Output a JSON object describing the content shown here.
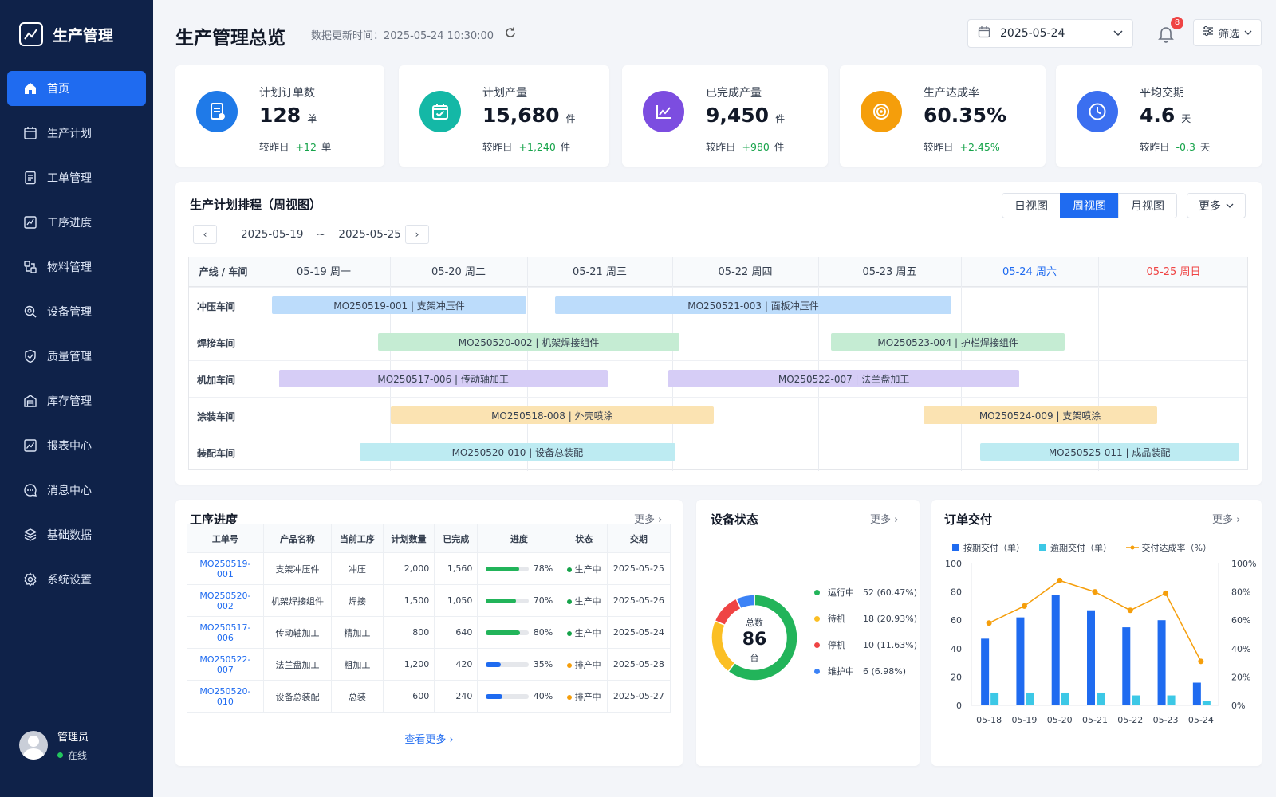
{
  "app": {
    "name": "生产管理"
  },
  "nav": [
    {
      "label": "首页",
      "icon": "home-icon",
      "active": true
    },
    {
      "label": "生产计划",
      "icon": "calendar-icon"
    },
    {
      "label": "工单管理",
      "icon": "document-icon"
    },
    {
      "label": "工序进度",
      "icon": "progress-icon"
    },
    {
      "label": "物料管理",
      "icon": "material-icon"
    },
    {
      "label": "设备管理",
      "icon": "search-icon"
    },
    {
      "label": "质量管理",
      "icon": "shield-icon"
    },
    {
      "label": "库存管理",
      "icon": "warehouse-icon"
    },
    {
      "label": "报表中心",
      "icon": "chart-icon"
    },
    {
      "label": "消息中心",
      "icon": "message-icon"
    },
    {
      "label": "基础数据",
      "icon": "layers-icon"
    },
    {
      "label": "系统设置",
      "icon": "gear-icon"
    }
  ],
  "user": {
    "name": "管理员",
    "status": "在线"
  },
  "header": {
    "title": "生产管理总览",
    "update_time": "数据更新时间：2025-05-24 10:30:00",
    "date": "2025-05-24",
    "notification_count": "8",
    "filter_label": "筛选"
  },
  "kpis": [
    {
      "label": "计划订单数",
      "value": "128",
      "unit": "单",
      "cmp_label": "较昨日",
      "delta": "+12",
      "delta_unit": "单",
      "color": "#1f7ae8"
    },
    {
      "label": "计划产量",
      "value": "15,680",
      "unit": "件",
      "cmp_label": "较昨日",
      "delta": "+1,240",
      "delta_unit": "件",
      "color": "#14b8a6"
    },
    {
      "label": "已完成产量",
      "value": "9,450",
      "unit": "件",
      "cmp_label": "较昨日",
      "delta": "+980",
      "delta_unit": "件",
      "color": "#7c4de0"
    },
    {
      "label": "生产达成率",
      "value": "60.35%",
      "unit": "",
      "cmp_label": "较昨日",
      "delta": "+2.45%",
      "delta_unit": "",
      "color": "#f59e0b"
    },
    {
      "label": "平均交期",
      "value": "4.6",
      "unit": "天",
      "cmp_label": "较昨日",
      "delta": "-0.3",
      "delta_unit": "天",
      "color": "#3b6ff0"
    }
  ],
  "schedule": {
    "title": "生产计划排程（周视图）",
    "views": [
      "日视图",
      "周视图",
      "月视图"
    ],
    "active_view": "周视图",
    "more_label": "更多",
    "range_start": "2025-05-19",
    "range_sep": "~",
    "range_end": "2025-05-25",
    "corner_label": "产线 / 车间",
    "days": [
      {
        "label": "05-19 周一",
        "color": "#374151"
      },
      {
        "label": "05-20 周二",
        "color": "#374151"
      },
      {
        "label": "05-21 周三",
        "color": "#374151"
      },
      {
        "label": "05-22 周四",
        "color": "#374151"
      },
      {
        "label": "05-23 周五",
        "color": "#374151"
      },
      {
        "label": "05-24 周六",
        "color": "#1f6bf0"
      },
      {
        "label": "05-25 周日",
        "color": "#ef4444"
      }
    ],
    "rows": [
      "冲压车间",
      "焊接车间",
      "机加车间",
      "涂装车间",
      "装配车间"
    ],
    "tasks": [
      {
        "row": 0,
        "label": "MO250519-001 | 支架冲压件",
        "start": 0.1,
        "end": 1.9,
        "color": "#bcdcfb"
      },
      {
        "row": 0,
        "label": "MO250521-003 | 面板冲压件",
        "start": 2.1,
        "end": 4.9,
        "color": "#bcdcfb"
      },
      {
        "row": 1,
        "label": "MO250520-002 | 机架焊接组件",
        "start": 0.85,
        "end": 2.98,
        "color": "#c5ecd3"
      },
      {
        "row": 1,
        "label": "MO250523-004 | 护栏焊接组件",
        "start": 4.05,
        "end": 5.7,
        "color": "#c5ecd3"
      },
      {
        "row": 2,
        "label": "MO250517-006 | 传动轴加工",
        "start": 0.15,
        "end": 2.47,
        "color": "#d6cdf6"
      },
      {
        "row": 2,
        "label": "MO250522-007 | 法兰盘加工",
        "start": 2.9,
        "end": 5.38,
        "color": "#d6cdf6"
      },
      {
        "row": 3,
        "label": "MO250518-008 | 外壳喷涂",
        "start": 0.94,
        "end": 3.22,
        "color": "#fbe3b2"
      },
      {
        "row": 3,
        "label": "MO250524-009 | 支架喷涂",
        "start": 4.7,
        "end": 6.35,
        "color": "#fbe3b2"
      },
      {
        "row": 4,
        "label": "MO250520-010 | 设备总装配",
        "start": 0.72,
        "end": 2.95,
        "color": "#bdebf2"
      },
      {
        "row": 4,
        "label": "MO250525-011 | 成品装配",
        "start": 5.1,
        "end": 6.93,
        "color": "#bdebf2"
      }
    ]
  },
  "process": {
    "title": "工序进度",
    "more": "更多",
    "columns": [
      "工单号",
      "产品名称",
      "当前工序",
      "计划数量",
      "已完成",
      "进度",
      "状态",
      "交期"
    ],
    "rows": [
      {
        "id": "MO250519-001",
        "product": "支架冲压件",
        "step": "冲压",
        "plan": "2,000",
        "done": "1,560",
        "pct": 78,
        "pct_label": "78%",
        "status": "生产中",
        "status_color": "#16a34a",
        "bar_color": "#22b45a",
        "due": "2025-05-25"
      },
      {
        "id": "MO250520-002",
        "product": "机架焊接组件",
        "step": "焊接",
        "plan": "1,500",
        "done": "1,050",
        "pct": 70,
        "pct_label": "70%",
        "status": "生产中",
        "status_color": "#16a34a",
        "bar_color": "#22b45a",
        "due": "2025-05-26"
      },
      {
        "id": "MO250517-006",
        "product": "传动轴加工",
        "step": "精加工",
        "plan": "800",
        "done": "640",
        "pct": 80,
        "pct_label": "80%",
        "status": "生产中",
        "status_color": "#16a34a",
        "bar_color": "#22b45a",
        "due": "2025-05-24"
      },
      {
        "id": "MO250522-007",
        "product": "法兰盘加工",
        "step": "粗加工",
        "plan": "1,200",
        "done": "420",
        "pct": 35,
        "pct_label": "35%",
        "status": "排产中",
        "status_color": "#f59e0b",
        "bar_color": "#1f6bf0",
        "due": "2025-05-28"
      },
      {
        "id": "MO250520-010",
        "product": "设备总装配",
        "step": "总装",
        "plan": "600",
        "done": "240",
        "pct": 40,
        "pct_label": "40%",
        "status": "排产中",
        "status_color": "#f59e0b",
        "bar_color": "#1f6bf0",
        "due": "2025-05-27"
      }
    ],
    "view_more": "查看更多"
  },
  "equipment": {
    "title": "设备状态",
    "more": "更多",
    "total_label": "总数",
    "total": "86",
    "unit": "台",
    "items": [
      {
        "label": "运行中",
        "value": 52,
        "text": "52 (60.47%)",
        "color": "#22b45a"
      },
      {
        "label": "待机",
        "value": 18,
        "text": "18 (20.93%)",
        "color": "#fbbf24"
      },
      {
        "label": "停机",
        "value": 10,
        "text": "10 (11.63%)",
        "color": "#ef4444"
      },
      {
        "label": "维护中",
        "value": 6,
        "text": "6 (6.98%)",
        "color": "#3b82f6"
      }
    ]
  },
  "delivery": {
    "title": "订单交付",
    "more": "更多",
    "legend": [
      "按期交付（单）",
      "逾期交付（单）",
      "交付达成率（%）"
    ]
  },
  "chart_data": {
    "type": "bar",
    "categories": [
      "05-18",
      "05-19",
      "05-20",
      "05-21",
      "05-22",
      "05-23",
      "05-24"
    ],
    "series": [
      {
        "name": "按期交付（单）",
        "type": "bar",
        "axis": "left",
        "color": "#1f6bf0",
        "values": [
          47,
          62,
          78,
          67,
          55,
          60,
          16
        ]
      },
      {
        "name": "逾期交付（单）",
        "type": "bar",
        "axis": "left",
        "color": "#3cc8e6",
        "values": [
          9,
          9,
          9,
          9,
          7,
          7,
          3
        ]
      },
      {
        "name": "交付达成率（%）",
        "type": "line",
        "axis": "right",
        "color": "#f59e0b",
        "values": [
          58,
          70,
          88,
          80,
          67,
          79,
          31
        ]
      }
    ],
    "ylim": [
      0,
      100
    ],
    "yticks": [
      "0",
      "20",
      "40",
      "60",
      "80",
      "100"
    ],
    "y2lim": [
      0,
      100
    ],
    "y2ticks": [
      "0%",
      "20%",
      "40%",
      "60%",
      "80%",
      "100%"
    ],
    "legend_position": "top"
  }
}
